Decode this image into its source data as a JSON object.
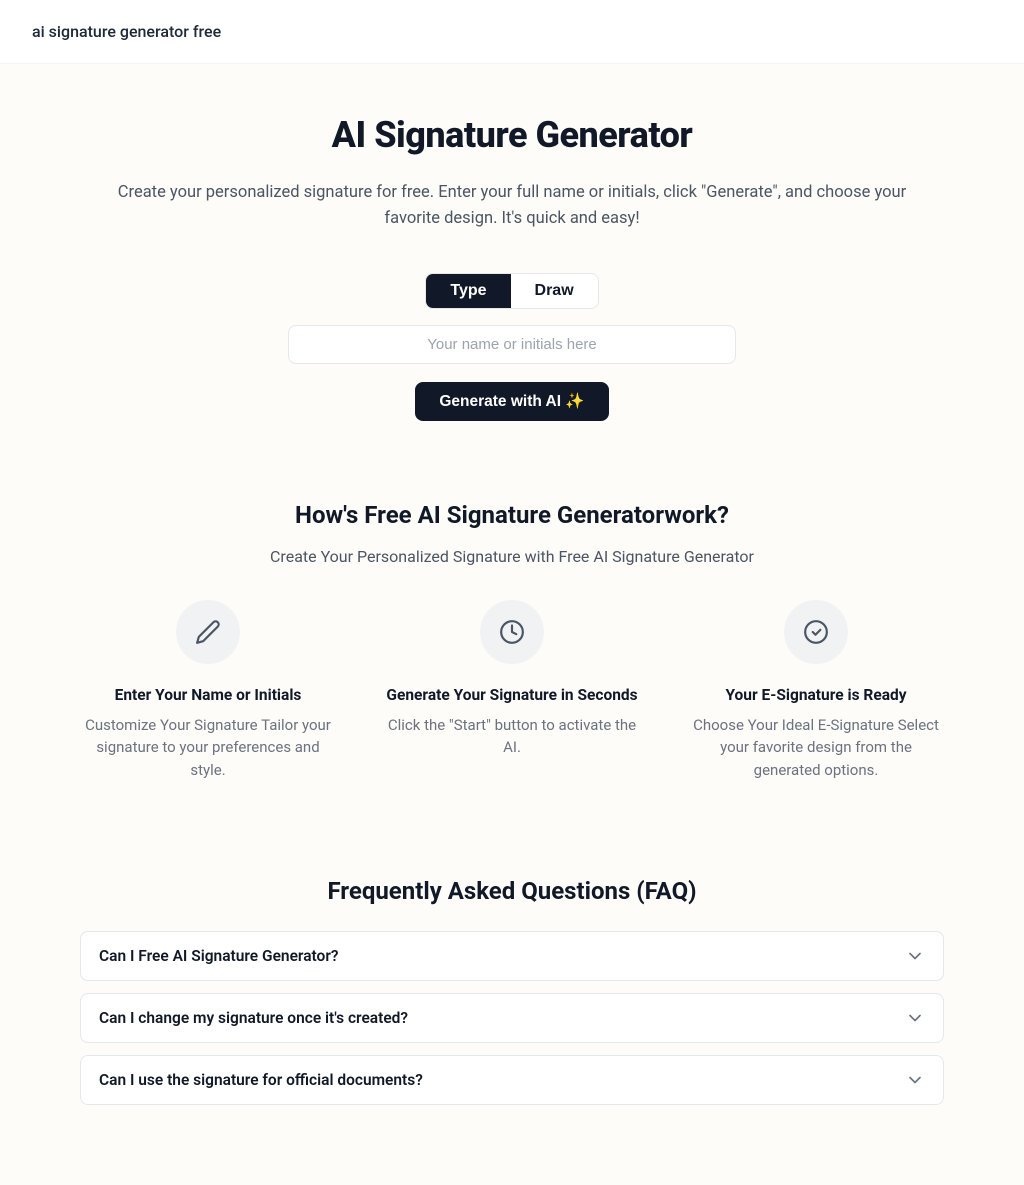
{
  "topbar": {
    "title": "ai signature generator free"
  },
  "hero": {
    "title": "AI Signature Generator",
    "subtitle": "Create your personalized signature for free. Enter your full name or initials, click \"Generate\", and choose your favorite design. It's quick and easy!",
    "tab_type": "Type",
    "tab_draw": "Draw",
    "input_placeholder": "Your name or initials here",
    "generate_label": "Generate with AI ✨"
  },
  "howitworks": {
    "title": "How's Free AI Signature Generatorwork?",
    "subtitle": "Create Your Personalized Signature with Free AI Signature Generator",
    "steps": [
      {
        "title": "Enter Your Name or Initials",
        "desc": "Customize Your Signature Tailor your signature to your preferences and style."
      },
      {
        "title": "Generate Your Signature in Seconds",
        "desc": "Click the \"Start\" button to activate the AI."
      },
      {
        "title": "Your E-Signature is Ready",
        "desc": "Choose Your Ideal E-Signature Select your favorite design from the generated options."
      }
    ]
  },
  "faq": {
    "title": "Frequently Asked Questions (FAQ)",
    "items": [
      {
        "q": "Can I Free AI Signature Generator?"
      },
      {
        "q": "Can I change my signature once it's created?"
      },
      {
        "q": "Can I use the signature for official documents?"
      }
    ]
  }
}
